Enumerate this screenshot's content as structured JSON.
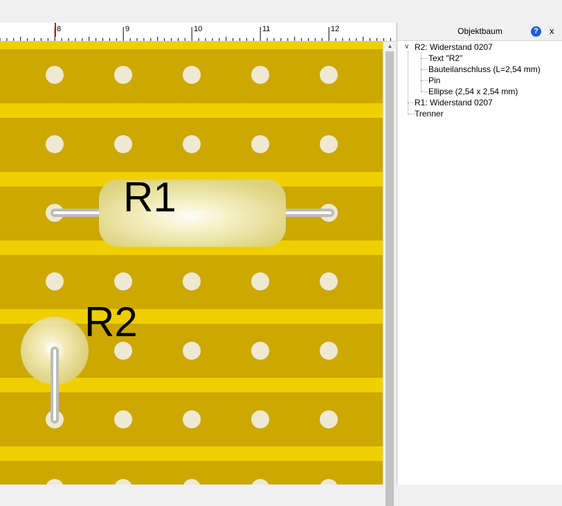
{
  "ruler": {
    "labels": [
      "8",
      "9",
      "10",
      "11",
      "12"
    ]
  },
  "board": {
    "component_labels": {
      "r1": "R1",
      "r2": "R2"
    },
    "colors": {
      "board": "#cca800",
      "strip": "#f0cf00",
      "hole": "#efe9d3",
      "wire": "#bcbcbc"
    }
  },
  "panel": {
    "title": "Objektbaum",
    "help_icon": "question-icon",
    "close_label": "x",
    "tree": [
      {
        "label": "R2: Widerstand 0207",
        "expanded": true,
        "children": [
          {
            "label": "Text \"R2\""
          },
          {
            "label": "Bauteilanschluss (L=2,54 mm)"
          },
          {
            "label": "Pin"
          },
          {
            "label": "Ellipse (2,54 x 2,54 mm)"
          }
        ]
      },
      {
        "label": "R1: Widerstand 0207"
      },
      {
        "label": "Trenner"
      }
    ]
  }
}
